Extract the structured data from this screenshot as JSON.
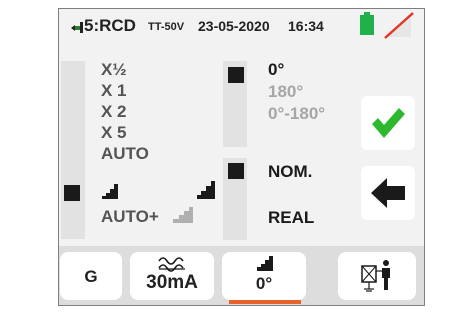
{
  "status_bar": {
    "mode": "5:RCD",
    "voltage_range": "TT-50V",
    "date": "23-05-2020",
    "time": "16:34",
    "battery_icon": "battery-icon",
    "network_icon": "no-wireless-icon"
  },
  "multiplier": {
    "options": [
      "X½",
      "X 1",
      "X 2",
      "X 5",
      "AUTO",
      "AUTO+"
    ],
    "selected": "AUTO+"
  },
  "phase": {
    "options": [
      "0°",
      "180°",
      "0°-180°"
    ],
    "selected": "0°"
  },
  "test_mode": {
    "options": [
      "NOM.",
      "REAL"
    ],
    "selected": "NOM."
  },
  "buttons": {
    "confirm_icon": "check-icon",
    "back_icon": "arrow-left-icon"
  },
  "toolbar": {
    "type_label": "G",
    "current_label": "30mA",
    "current_icon": "ac-dc-wave-icon",
    "phase_label": "0°",
    "phase_icon": "ramp-icon",
    "connection_icon": "installation-icon"
  },
  "colors": {
    "battery": "#21b14a",
    "check": "#2eb82e",
    "selected_underline": "#e8622c",
    "no_wireless_slash": "#e0362c"
  }
}
